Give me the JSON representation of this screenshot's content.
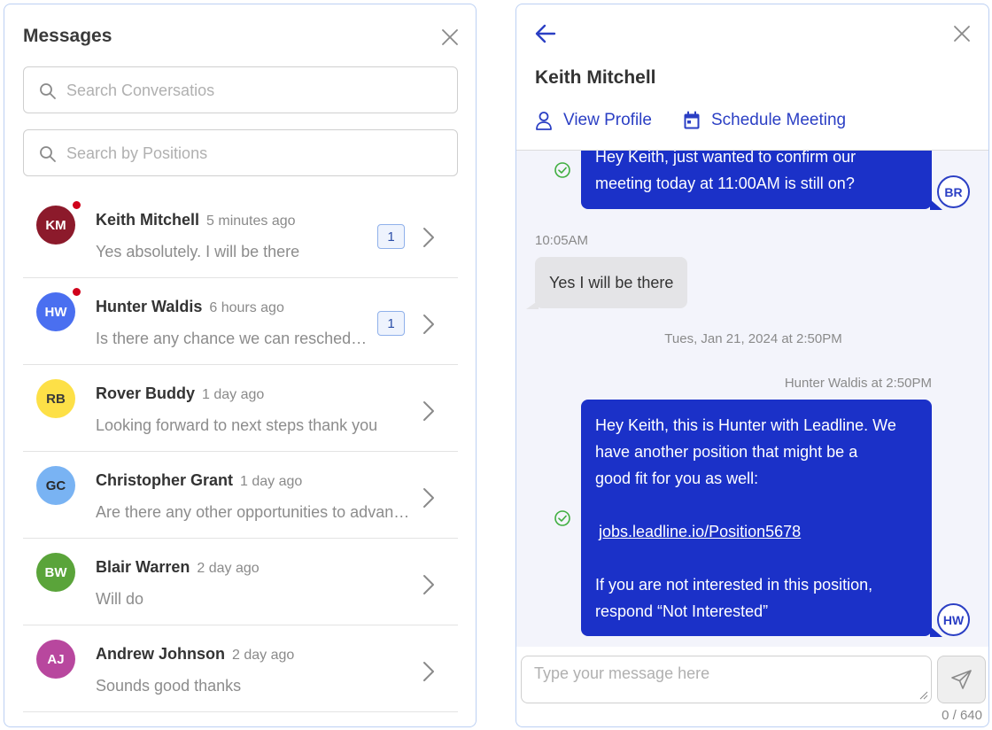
{
  "messages_panel": {
    "title": "Messages",
    "search_conversations": {
      "placeholder": "Search Conversatios",
      "value": ""
    },
    "search_positions": {
      "placeholder": "Search by Positions",
      "value": ""
    },
    "conversations": [
      {
        "initials": "KM",
        "name": "Keith Mitchell",
        "time": "5 minutes ago",
        "preview": "Yes absolutely. I will be there",
        "unread": "1",
        "avatar_bg": "#8c1a2b",
        "avatar_fg": "#ffffff"
      },
      {
        "initials": "HW",
        "name": "Hunter Waldis",
        "time": "6 hours ago",
        "preview": "Is there any chance we can reschedule our meeting?",
        "unread": "1",
        "avatar_bg": "#4a6ff0",
        "avatar_fg": "#ffffff"
      },
      {
        "initials": "RB",
        "name": "Rover Buddy",
        "time": "1 day ago",
        "preview": "Looking forward to next steps thank you",
        "unread": "",
        "avatar_bg": "#fde047",
        "avatar_fg": "#3a3a3a"
      },
      {
        "initials": "GC",
        "name": "Christopher Grant",
        "time": "1 day ago",
        "preview": "Are there any other opportunities to advance?",
        "unread": "",
        "avatar_bg": "#79b3f3",
        "avatar_fg": "#2a2a2a"
      },
      {
        "initials": "BW",
        "name": "Blair Warren",
        "time": "2 day ago",
        "preview": "Will do",
        "unread": "",
        "avatar_bg": "#5aa43a",
        "avatar_fg": "#ffffff"
      },
      {
        "initials": "AJ",
        "name": "Andrew Johnson",
        "time": "2 day ago",
        "preview": "Sounds good thanks",
        "unread": "",
        "avatar_bg": "#b8479e",
        "avatar_fg": "#ffffff"
      }
    ]
  },
  "chat_panel": {
    "contact_name": "Keith Mitchell",
    "view_profile_label": "View Profile",
    "schedule_meeting_label": "Schedule Meeting",
    "messages": {
      "m1_line1": "Hey Keith, just wanted to confirm our",
      "m1_line2": "meeting today at 11:00AM is still on?",
      "m1_avatar": "BR",
      "reply_time": "10:05AM",
      "reply_text": "Yes I will be there",
      "date_divider": "Tues, Jan 21, 2024 at 2:50PM",
      "sender_meta": "Hunter Waldis at 2:50PM",
      "m2_line1": "Hey Keith, this is Hunter with Leadline. We",
      "m2_line2": "have another position that might be a",
      "m2_line3": "good fit for you as well:",
      "m2_link": "jobs.leadline.io/Position5678",
      "m2_line4": "If you are not interested in this position,",
      "m2_line5": "respond “Not Interested”",
      "m2_avatar": "HW"
    },
    "composer": {
      "placeholder": "Type your message here",
      "value": ""
    },
    "counter": "0 / 640"
  },
  "colors": {
    "accent": "#2b3fc4",
    "outgoing_bubble": "#1b31c8",
    "incoming_bubble": "#e4e4e7",
    "chat_bg": "#f3f4fb",
    "unread_dot": "#d0021b",
    "read_check": "#3fae3f"
  },
  "icons": [
    "close-icon",
    "search-icon",
    "chevron-right-icon",
    "back-arrow-icon",
    "user-icon",
    "calendar-icon",
    "check-circle-icon",
    "send-icon"
  ]
}
